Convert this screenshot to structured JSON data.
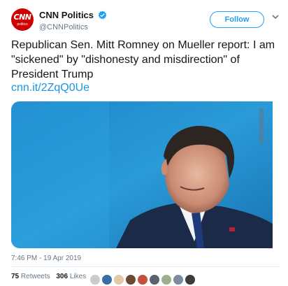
{
  "account": {
    "avatar_logo": "CNN",
    "avatar_sub": "politics",
    "display_name": "CNN Politics",
    "handle": "@CNNPolitics",
    "follow_label": "Follow",
    "verified_icon": "verified-badge-icon"
  },
  "tweet": {
    "text": "Republican Sen. Mitt Romney on Mueller report: I am \"sickened\" by \"dishonesty and misdirection\" of President Trump",
    "link": "cnn.it/2ZqQ0Ue",
    "timestamp": "7:46 PM - 19 Apr 2019"
  },
  "stats": {
    "retweets_count": "75",
    "retweets_label": "Retweets",
    "likes_count": "306",
    "likes_label": "Likes"
  },
  "likers": [
    {
      "color": "#c8cdd2"
    },
    {
      "color": "#3a6ea5"
    },
    {
      "color": "#e0c9a6"
    },
    {
      "color": "#6b4a34"
    },
    {
      "color": "#c84f3a"
    },
    {
      "color": "#58636e"
    },
    {
      "color": "#9bb08c"
    },
    {
      "color": "#7a8d9c"
    },
    {
      "color": "#3b3b3b"
    }
  ],
  "colors": {
    "brand_red": "#cc0000",
    "twitter_blue": "#1da1f2",
    "link_blue": "#1b95e0",
    "muted_gray": "#657786"
  }
}
